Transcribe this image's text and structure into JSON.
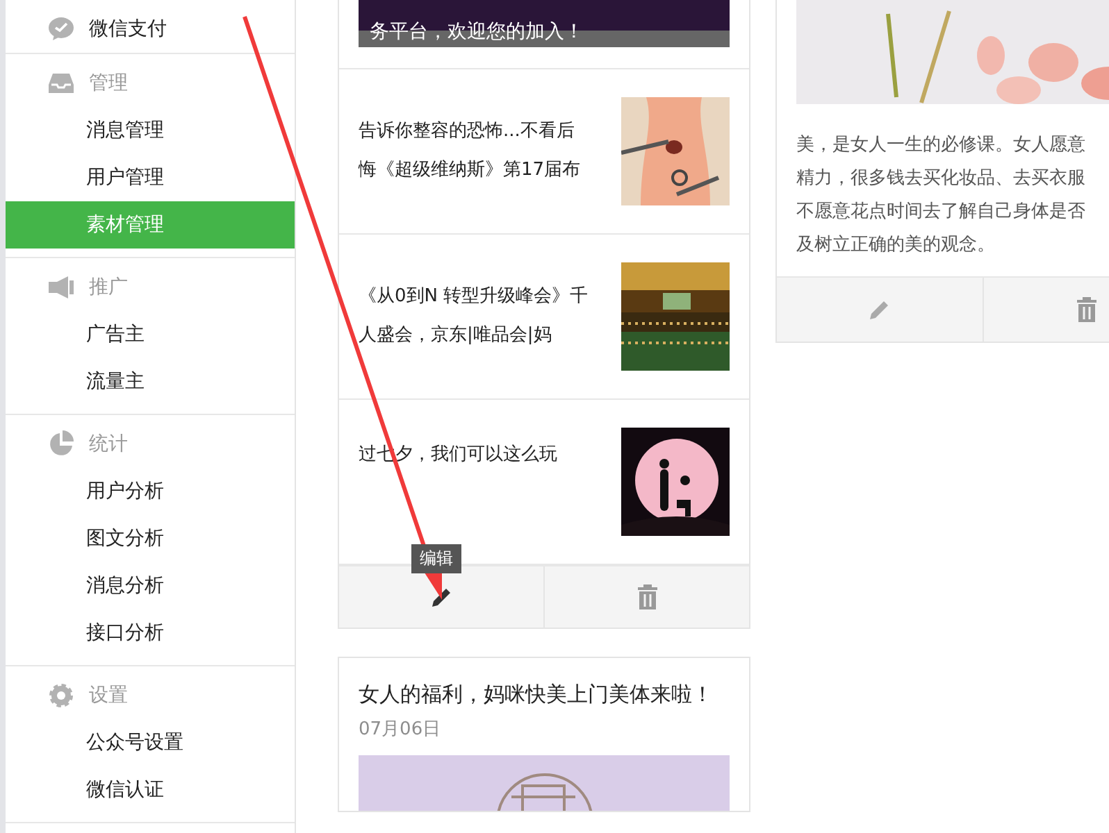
{
  "sidebar": {
    "sections": [
      {
        "title": "微信支付"
      },
      {
        "title": "管理",
        "items": [
          {
            "label": "消息管理",
            "selected": false
          },
          {
            "label": "用户管理",
            "selected": false
          },
          {
            "label": "素材管理",
            "selected": true
          }
        ]
      },
      {
        "title": "推广",
        "items": [
          {
            "label": "广告主",
            "selected": false
          },
          {
            "label": "流量主",
            "selected": false
          }
        ]
      },
      {
        "title": "统计",
        "items": [
          {
            "label": "用户分析",
            "selected": false
          },
          {
            "label": "图文分析",
            "selected": false
          },
          {
            "label": "消息分析",
            "selected": false
          },
          {
            "label": "接口分析",
            "selected": false
          }
        ]
      },
      {
        "title": "设置",
        "items": [
          {
            "label": "公众号设置",
            "selected": false
          },
          {
            "label": "微信认证",
            "selected": false
          }
        ]
      }
    ]
  },
  "middle_column": {
    "cards": [
      {
        "kind": "multi",
        "cover_caption": "务平台，欢迎您的加入！",
        "items": [
          {
            "title": "告诉你整容的恐怖...不看后悔《超级维纳斯》第17届布"
          },
          {
            "title": "《从0到N 转型升级峰会》千人盛会，京东|唯品会|妈"
          },
          {
            "title": "过七夕，我们可以这么玩"
          }
        ],
        "tooltip": "编辑"
      },
      {
        "kind": "single",
        "title": "女人的福利，妈咪快美上门美体来啦！",
        "date": "07月06日"
      }
    ]
  },
  "right_column": {
    "card": {
      "paragraph_lines": [
        "美，是女人一生的必修课。女人愿意",
        "精力，很多钱去买化妆品、去买衣服",
        "不愿意花点时间去了解自己身体是否",
        "及树立正确的美的观念。"
      ]
    }
  }
}
